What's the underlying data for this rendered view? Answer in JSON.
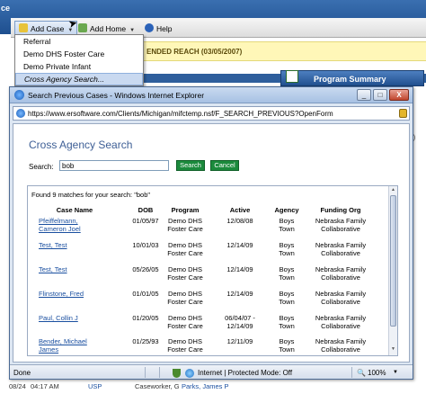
{
  "background": {
    "logo_fragment": "ce",
    "toolbar": {
      "add_case_label": "Add Case",
      "add_home_label": "Add Home",
      "help_label": "Help"
    },
    "reach_banner": "ENDED REACH (03/05/2007)",
    "program_summary_label": "Program Summary",
    "edge_text": "d)",
    "bottom_row": {
      "date": "08/24",
      "time": "04:17 AM",
      "tag": "USP",
      "role": "Caseworker, G",
      "name": "Parks, James P"
    }
  },
  "menu": {
    "items": [
      "Referral",
      "Demo DHS Foster Care",
      "Demo Private Infant",
      "Cross Agency Search..."
    ],
    "highlighted_index": 3
  },
  "window": {
    "title": "Search Previous Cases - Windows Internet Explorer",
    "buttons": [
      "_",
      "□",
      "X"
    ],
    "url": "https://www.ersoftware.com/Clients/Michigan/mifctemp.nsf/F_SEARCH_PREVIOUS?OpenForm",
    "page_title": "Cross Agency Search",
    "search_label": "Search:",
    "search_value": "bob",
    "search_button": "Search",
    "cancel_button": "Cancel",
    "results_summary": "Found 9 matches for your search: \"bob\"",
    "columns": [
      "Case Name",
      "DOB",
      "Program",
      "Active",
      "Agency",
      "Funding Org"
    ],
    "rows": [
      {
        "name": "Pfeiffelmann, Cameron Joel",
        "dob": "01/05/97",
        "program": "Demo DHS Foster Care",
        "active": "12/08/08",
        "agency": "Boys Town",
        "funding": "Nebraska Family Collaborative"
      },
      {
        "name": "Test, Test",
        "dob": "10/01/03",
        "program": "Demo DHS Foster Care",
        "active": "12/14/09",
        "agency": "Boys Town",
        "funding": "Nebraska Family Collaborative"
      },
      {
        "name": "Test, Test",
        "dob": "05/26/05",
        "program": "Demo DHS Foster Care",
        "active": "12/14/09",
        "agency": "Boys Town",
        "funding": "Nebraska Family Collaborative"
      },
      {
        "name": "Flinstone, Fred",
        "dob": "01/01/05",
        "program": "Demo DHS Foster Care",
        "active": "12/14/09",
        "agency": "Boys Town",
        "funding": "Nebraska Family Collaborative"
      },
      {
        "name": "Paul, Collin J",
        "dob": "01/20/05",
        "program": "Demo DHS Foster Care",
        "active": "06/04/07 - 12/14/09",
        "agency": "Boys Town",
        "funding": "Nebraska Family Collaborative"
      },
      {
        "name": "Bender, Michael James",
        "dob": "01/25/93",
        "program": "Demo DHS Foster Care",
        "active": "12/11/09",
        "agency": "Boys Town",
        "funding": "Nebraska Family Collaborative"
      }
    ],
    "status_left": "Done",
    "status_zone": "Internet | Protected Mode: Off",
    "zoom": "100%"
  }
}
